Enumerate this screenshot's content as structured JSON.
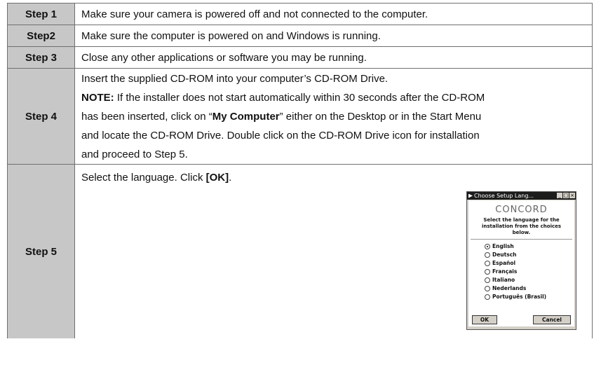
{
  "steps": [
    {
      "label": "Step 1",
      "text": "Make sure your camera is powered off and not connected to the computer."
    },
    {
      "label": "Step2",
      "text": "Make sure the computer is powered on and Windows is running."
    },
    {
      "label": "Step 3",
      "text": "Close any other applications or software you may be running."
    },
    {
      "label": "Step 4",
      "line1": "Insert the supplied CD-ROM into your computer’s CD-ROM Drive.",
      "note_label": "NOTE:",
      "note_text": " If the installer does not start automatically within 30 seconds after the CD-ROM",
      "line3a": "has been inserted, click on “",
      "line3b": "My Computer",
      "line3c": "” either on the Desktop or in the Start Menu",
      "line4": "and locate the CD-ROM Drive. Double click on the CD-ROM Drive icon for installation",
      "line5": "and proceed to Step 5."
    },
    {
      "label": "Step 5",
      "text_a": "Select the language. Click ",
      "text_b": "[OK]",
      "text_c": "."
    }
  ],
  "dialog": {
    "title": "Choose Setup Lang...",
    "brand": "CONCORD",
    "prompt": "Select the language for the installation from the choices below.",
    "options": [
      "English",
      "Deutsch",
      "Español",
      "Français",
      "Italiano",
      "Nederlands",
      "Português (Brasil)"
    ],
    "selected": "English",
    "ok_label": "OK",
    "cancel_label": "Cancel",
    "minimize_glyph": "_",
    "maximize_glyph": "□",
    "close_glyph": "×"
  }
}
